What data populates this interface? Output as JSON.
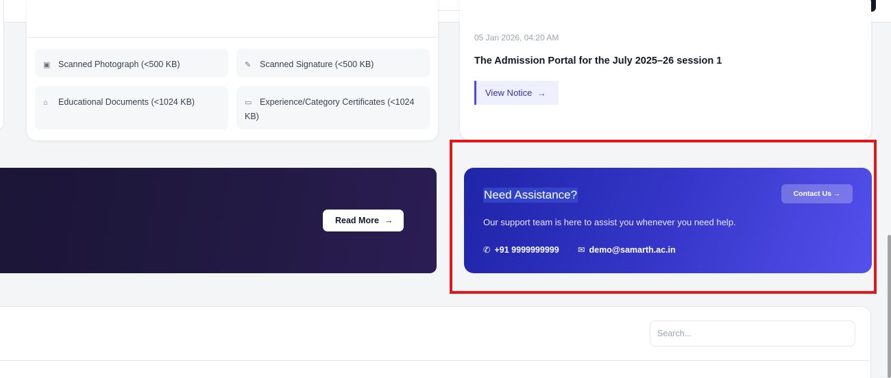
{
  "documents": {
    "items": [
      {
        "icon": "image-icon",
        "label": "Scanned Photograph (<500 KB)"
      },
      {
        "icon": "pen-icon",
        "label": "Scanned Signature (<500 KB)"
      },
      {
        "icon": "graduation-cap-icon",
        "label": "Educational Documents (<1024 KB)"
      },
      {
        "icon": "id-card-icon",
        "label": "Experience/Category Certificates (<1024 KB)"
      }
    ]
  },
  "notice": {
    "date": "05 Jan 2026, 04:20 AM",
    "title": "The Admission Portal for the July 2025–26 session 1",
    "button_label": "View Notice",
    "button_arrow": "→"
  },
  "banner": {
    "read_more_label": "Read More",
    "read_more_arrow": "→"
  },
  "assistance": {
    "title": "Need Assistance?",
    "contact_button_label": "Contact Us →",
    "description": "Our support team is here to assist you whenever you need help.",
    "phone": "+91 9999999999",
    "email": "demo@samarth.ac.in"
  },
  "table": {
    "search_placeholder": "Search..."
  },
  "colors": {
    "accent": "#4f46e5",
    "highlight": "#e3161b",
    "banner_dark": "#1b1536"
  }
}
